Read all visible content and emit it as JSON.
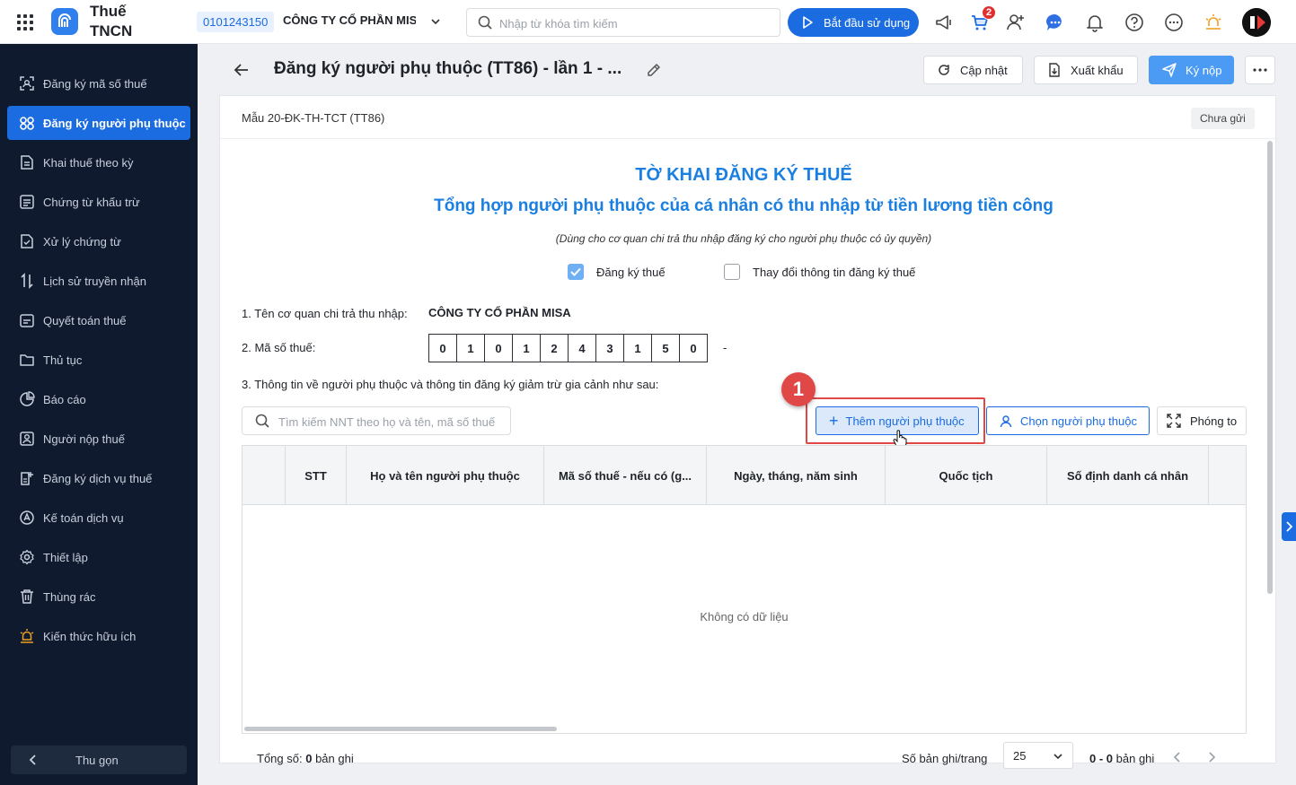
{
  "topbar": {
    "app_title": "Thuế TNCN",
    "tax_code": "0101243150",
    "company_name": "CÔNG TY CỔ PHẦN MISA",
    "search_placeholder": "Nhập từ khóa tìm kiếm",
    "start_button": "Bắt đầu sử dụng",
    "cart_badge": "2",
    "icons": [
      "megaphone-icon",
      "cart-icon",
      "add-user-icon",
      "chat-icon",
      "bell-icon",
      "help-icon",
      "more-icon",
      "idea-icon"
    ]
  },
  "sidebar": {
    "items": [
      {
        "label": "Đăng ký mã số thuế",
        "icon": "scan-id-icon"
      },
      {
        "label": "Đăng ký người phụ thuộc",
        "icon": "people-icon",
        "active": true
      },
      {
        "label": "Khai thuế theo kỳ",
        "icon": "document-icon"
      },
      {
        "label": "Chứng từ khấu trừ",
        "icon": "receipt-icon"
      },
      {
        "label": "Xử lý chứng từ",
        "icon": "process-doc-icon"
      },
      {
        "label": "Lịch sử truyền nhận",
        "icon": "transfer-icon"
      },
      {
        "label": "Quyết toán thuế",
        "icon": "settlement-icon"
      },
      {
        "label": "Thủ tục",
        "icon": "folder-icon"
      },
      {
        "label": "Báo cáo",
        "icon": "report-icon"
      },
      {
        "label": "Người nộp thuế",
        "icon": "taxpayer-icon"
      },
      {
        "label": "Đăng ký dịch vụ thuế",
        "icon": "service-icon"
      },
      {
        "label": "Kế toán dịch vụ",
        "icon": "accounting-icon"
      },
      {
        "label": "Thiết lập",
        "icon": "gear-icon"
      },
      {
        "label": "Thùng rác",
        "icon": "trash-icon"
      },
      {
        "label": "Kiến thức hữu ích",
        "icon": "knowledge-icon"
      }
    ],
    "collapse_label": "Thu gọn"
  },
  "header": {
    "title": "Đăng ký người phụ thuộc (TT86) - lần 1 - ...",
    "update_button": "Cập nhật",
    "export_button": "Xuất khẩu",
    "submit_button": "Ký nộp"
  },
  "form": {
    "form_code": "Mẫu 20-ĐK-TH-TCT (TT86)",
    "status": "Chưa gửi",
    "title_1": "TỜ KHAI ĐĂNG KÝ THUẾ",
    "title_2": "Tổng hợp người phụ thuộc của cá nhân có thu nhập từ tiền lương tiền công",
    "subtitle": "(Dùng cho cơ quan chi trả thu nhập đăng ký cho người phụ thuộc có ủy quyền)",
    "checkbox_register": {
      "label": "Đăng ký thuế",
      "checked": true
    },
    "checkbox_change": {
      "label": "Thay đổi thông tin đăng ký thuế",
      "checked": false
    },
    "field_1_label": "1. Tên cơ quan chi trả thu nhập:",
    "field_1_value": "CÔNG TY CỔ PHẦN MISA",
    "field_2_label": "2. Mã số thuế:",
    "tax_digits": [
      "0",
      "1",
      "0",
      "1",
      "2",
      "4",
      "3",
      "1",
      "5",
      "0"
    ],
    "tax_suffix": "-",
    "field_3_label": "3. Thông tin về người phụ thuộc và thông tin đăng ký giảm trừ gia cảnh như sau:",
    "search_placeholder": "Tìm kiếm NNT theo họ và tên, mã số thuế",
    "step_number": "1",
    "add_button": "Thêm người phụ thuộc",
    "pick_button": "Chọn người phụ thuộc",
    "zoom_button": "Phóng to"
  },
  "table": {
    "columns": [
      "",
      "STT",
      "Họ và tên người phụ thuộc",
      "Mã số thuế - nếu có (g...",
      "Ngày, tháng, năm sinh",
      "Quốc tịch",
      "Số định danh cá nhân",
      ""
    ],
    "empty_text": "Không có dữ liệu"
  },
  "footer": {
    "total_prefix": "Tổng số:",
    "total_count": "0",
    "total_suffix": "bản ghi",
    "per_page_label": "Số bản ghi/trang",
    "per_page_value": "25",
    "range": "0 - 0",
    "range_suffix": "bản ghi"
  }
}
